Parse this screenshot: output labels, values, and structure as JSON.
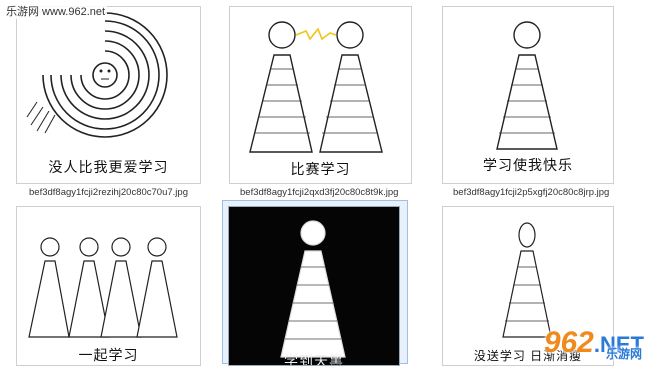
{
  "watermark": "乐游网 www.962.net",
  "tiles": [
    {
      "caption": "没人比我更爱学习",
      "filename": "bef3df8agy1fcji2rezihj20c80c70u7.jpg"
    },
    {
      "caption": "比赛学习",
      "filename": "bef3df8agy1fcji2qxd3fj20c80c8t9k.jpg"
    },
    {
      "caption": "学习使我快乐",
      "filename": "bef3df8agy1fcji2p5xgfj20c80c8jrp.jpg"
    },
    {
      "caption": "一起学习",
      "filename": ""
    },
    {
      "caption": "学到天黑",
      "filename": ""
    },
    {
      "caption": "没送学习 日渐消瘦",
      "filename": ""
    }
  ],
  "brand": {
    "number": "962",
    "net": ".NET",
    "sub": "乐游网"
  }
}
